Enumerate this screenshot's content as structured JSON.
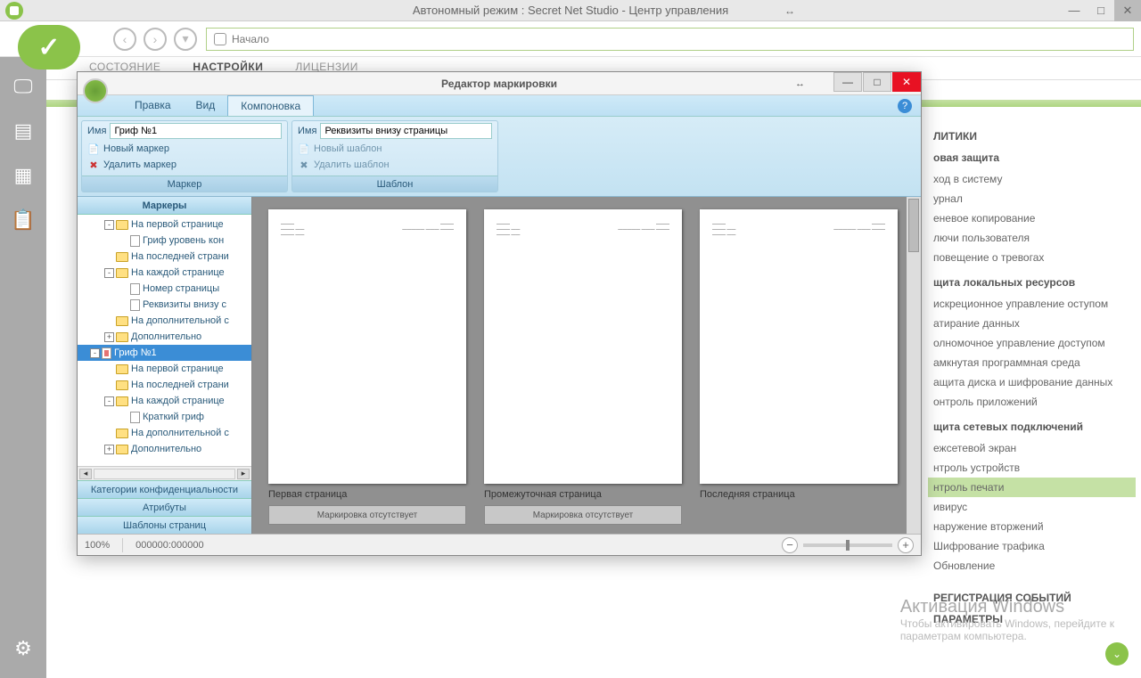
{
  "mainWindow": {
    "title": "Автономный режим : Secret Net Studio - Центр управления",
    "breadcrumb": "Начало"
  },
  "navTabs": {
    "state": "СОСТОЯНИЕ",
    "settings": "НАСТРОЙКИ",
    "licenses": "ЛИЦЕНЗИИ"
  },
  "policies": {
    "header1": "ЛИТИКИ",
    "group1": "овая защита",
    "items1": [
      "ход в систему",
      "урнал",
      "еневое копирование",
      "лючи пользователя",
      "повещение о тревогах"
    ],
    "group2": "щита локальных ресурсов",
    "items2": [
      "искреционное управление оступом",
      "атирание данных",
      "олномочное управление доступом",
      "амкнутая программная среда",
      "ащита диска и шифрование данных",
      "онтроль приложений"
    ],
    "group3": "щита сетевых подключений",
    "items3": [
      "ежсетевой экран",
      "нтроль устройств"
    ],
    "selected": "нтроль печати",
    "items4": [
      "ивирус",
      "наружение вторжений",
      "Шифрование трафика",
      "Обновление"
    ],
    "footer1": "РЕГИСТРАЦИЯ СОБЫТИЙ",
    "footer2": "ПАРАМЕТРЫ"
  },
  "watermark": {
    "l1": "Активация Windows",
    "l2": "Чтобы активировать Windows, перейдите к",
    "l3": "параметрам компьютера."
  },
  "modal": {
    "title": "Редактор маркировки",
    "menu": {
      "edit": "Правка",
      "view": "Вид",
      "layout": "Компоновка"
    },
    "ribbon": {
      "nameLabel": "Имя",
      "markerName": "Гриф №1",
      "newMarker": "Новый маркер",
      "deleteMarker": "Удалить маркер",
      "markerGroup": "Маркер",
      "templateName": "Реквизиты внизу страницы",
      "newTemplate": "Новый шаблон",
      "deleteTemplate": "Удалить шаблон",
      "templateGroup": "Шаблон"
    },
    "treeHeader": "Маркеры",
    "tree": [
      {
        "depth": 1,
        "toggle": "-",
        "icon": "folder",
        "label": "На первой странице"
      },
      {
        "depth": 2,
        "toggle": "",
        "icon": "file",
        "label": "Гриф уровень кон"
      },
      {
        "depth": 1,
        "toggle": "",
        "icon": "folder",
        "label": "На последней страни"
      },
      {
        "depth": 1,
        "toggle": "-",
        "icon": "folder",
        "label": "На каждой странице"
      },
      {
        "depth": 2,
        "toggle": "",
        "icon": "file",
        "label": "Номер страницы"
      },
      {
        "depth": 2,
        "toggle": "",
        "icon": "file",
        "label": "Реквизиты внизу с"
      },
      {
        "depth": 1,
        "toggle": "",
        "icon": "folder",
        "label": "На дополнительной с"
      },
      {
        "depth": 1,
        "toggle": "+",
        "icon": "folder",
        "label": "Дополнительно"
      },
      {
        "depth": 0,
        "toggle": "-",
        "icon": "file-red",
        "label": "Гриф №1",
        "selected": true
      },
      {
        "depth": 1,
        "toggle": "",
        "icon": "folder",
        "label": "На первой странице"
      },
      {
        "depth": 1,
        "toggle": "",
        "icon": "folder",
        "label": "На последней страни"
      },
      {
        "depth": 1,
        "toggle": "-",
        "icon": "folder",
        "label": "На каждой странице"
      },
      {
        "depth": 2,
        "toggle": "",
        "icon": "file",
        "label": "Краткий гриф"
      },
      {
        "depth": 1,
        "toggle": "",
        "icon": "folder",
        "label": "На дополнительной с"
      },
      {
        "depth": 1,
        "toggle": "+",
        "icon": "folder",
        "label": "Дополнительно"
      }
    ],
    "accordion": [
      "Категории конфиденциальности",
      "Атрибуты",
      "Шаблоны страниц"
    ],
    "pages": {
      "firstLabel": "Первая страница",
      "middleLabel": "Промежуточная страница",
      "lastLabel": "Последняя страница",
      "marking": "Маркировка отсутствует"
    },
    "status": {
      "zoom": "100%",
      "coords": "000000:000000"
    }
  }
}
